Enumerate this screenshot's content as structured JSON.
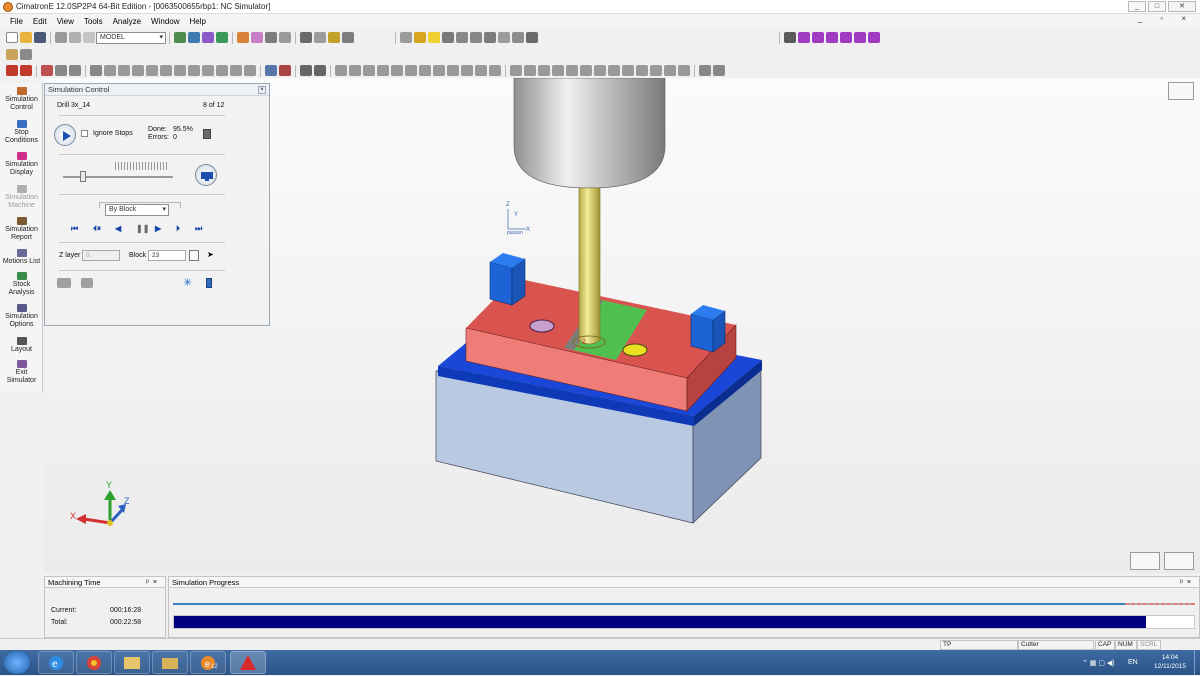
{
  "window": {
    "title": "CimatronE 12.0SP2P4  64-Bit Edition - [0063500655rbp1: NC Simulator]",
    "controls": [
      "_",
      "□",
      "✕"
    ]
  },
  "menu": [
    "File",
    "Edit",
    "View",
    "Tools",
    "Analyze",
    "Window",
    "Help"
  ],
  "mdi_controls": "_ ▫ ×",
  "toolbar": {
    "model_combo": "MODEL"
  },
  "sidebar": [
    {
      "label": "Simulation Control",
      "icon": "simulation-control-icon"
    },
    {
      "label": "Stop Conditions",
      "icon": "stop-conditions-icon"
    },
    {
      "label": "Simulation Display",
      "icon": "simulation-display-icon"
    },
    {
      "label": "Simulation Machine",
      "icon": "simulation-machine-icon",
      "disabled": true
    },
    {
      "label": "Simulation Report",
      "icon": "simulation-report-icon"
    },
    {
      "label": "Motions List",
      "icon": "motions-list-icon"
    },
    {
      "label": "Stock Analysis",
      "icon": "stock-analysis-icon"
    },
    {
      "label": "Simulation Options",
      "icon": "simulation-options-icon"
    },
    {
      "label": "Layout",
      "icon": "layout-icon"
    },
    {
      "label": "Exit Simulator",
      "icon": "exit-simulator-icon"
    }
  ],
  "sim_panel": {
    "title": "Simulation Control",
    "procedure": "Drill 3x_14",
    "counter": "8 of 12",
    "ignore_stops": "Ignore Stops",
    "done_label": "Done:",
    "done_value": "95.5%",
    "errors_label": "Errors:",
    "errors_value": "0",
    "step_mode": "By Block",
    "zlayer_label": "Z layer",
    "zlayer_value": "0.",
    "block_label": "Block",
    "block_value": "23",
    "speed_level": 0.18
  },
  "viewport": {
    "view_label": "pusssn",
    "coord_labels": {
      "z": "Z",
      "y": "Y",
      "x": "X"
    },
    "triad_labels": {
      "x": "X",
      "y": "Y",
      "z": "Z"
    }
  },
  "machining_time": {
    "title": "Machining Time",
    "current_label": "Current:",
    "current_value": "000:16:28",
    "total_label": "Total:",
    "total_value": "000:22:58"
  },
  "simulation_progress": {
    "title": "Simulation Progress",
    "progress": 0.953,
    "colors": {
      "bar": "#000080",
      "track_line": "#3b80c6"
    }
  },
  "statusbar": {
    "fields": [
      "TP",
      "Cutter",
      "CAP",
      "NUM",
      "SCRL"
    ]
  },
  "taskbar": {
    "time": "14:04",
    "date": "12/11/2015",
    "language": "EN",
    "ecimatron_badge": "12"
  }
}
